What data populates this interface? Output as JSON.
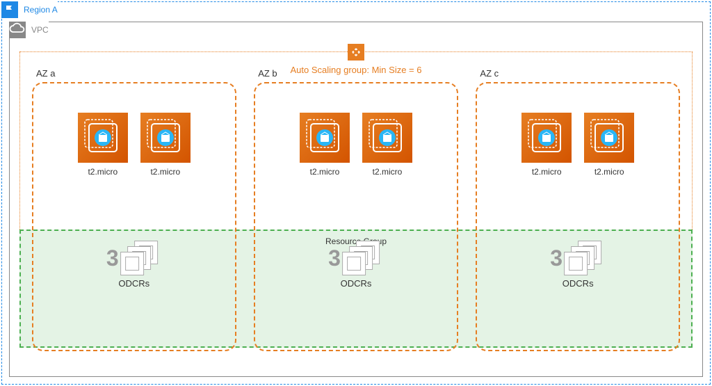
{
  "region": {
    "label": "Region A"
  },
  "vpc": {
    "label": "VPC"
  },
  "asg": {
    "label": "Auto Scaling group: Min Size = 6"
  },
  "resource_group": {
    "label": "Resource Group"
  },
  "azs": [
    {
      "label": "AZ a",
      "instances": [
        {
          "type": "t2.micro"
        },
        {
          "type": "t2.micro"
        }
      ],
      "odcr": {
        "count": "3",
        "label": "ODCRs"
      }
    },
    {
      "label": "AZ b",
      "instances": [
        {
          "type": "t2.micro"
        },
        {
          "type": "t2.micro"
        }
      ],
      "odcr": {
        "count": "3",
        "label": "ODCRs"
      }
    },
    {
      "label": "AZ c",
      "instances": [
        {
          "type": "t2.micro"
        },
        {
          "type": "t2.micro"
        }
      ],
      "odcr": {
        "count": "3",
        "label": "ODCRs"
      }
    }
  ]
}
